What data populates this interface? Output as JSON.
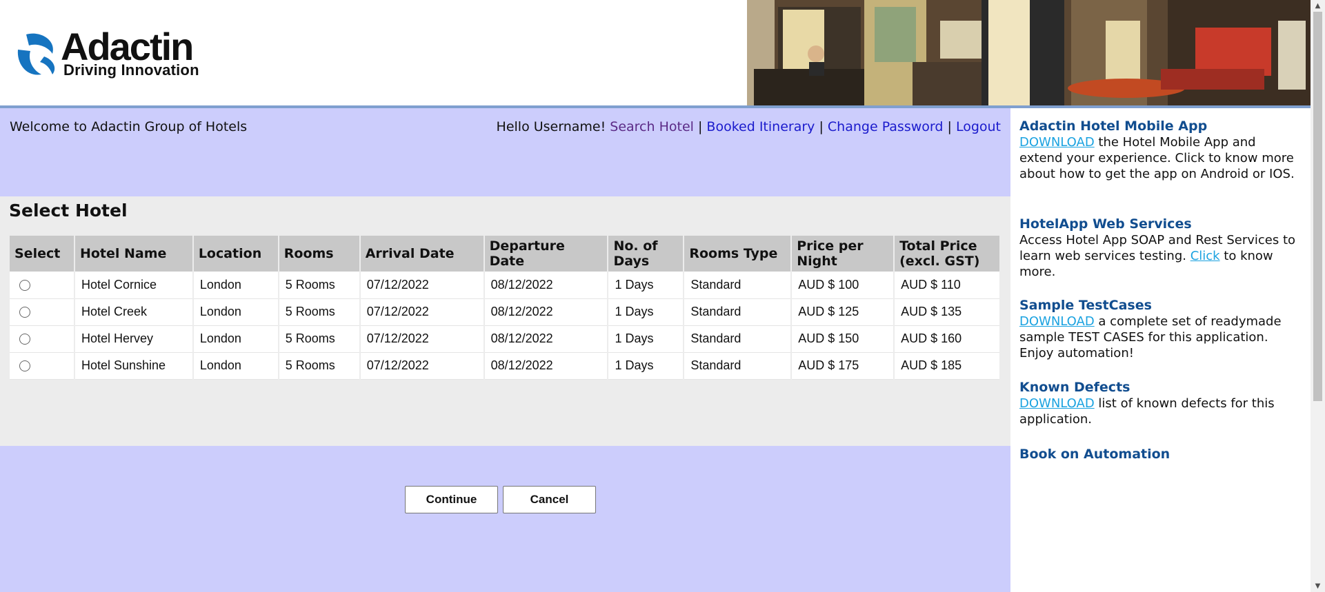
{
  "header": {
    "logo_name": "Adactin",
    "logo_tagline": "Driving Innovation"
  },
  "topbar": {
    "welcome": "Welcome to Adactin Group of Hotels",
    "greeting": "Hello Username!",
    "links": {
      "search_hotel": "Search Hotel",
      "booked_itinerary": "Booked Itinerary",
      "change_password": "Change Password",
      "logout": "Logout"
    },
    "separator": "|"
  },
  "main": {
    "heading": "Select Hotel",
    "table": {
      "columns": [
        "Select",
        "Hotel Name",
        "Location",
        "Rooms",
        "Arrival Date",
        "Departure Date",
        "No. of Days",
        "Rooms Type",
        "Price per Night",
        "Total Price (excl. GST)"
      ],
      "rows": [
        {
          "hotel": "Hotel Cornice",
          "location": "London",
          "rooms": "5 Rooms",
          "arrival": "07/12/2022",
          "departure": "08/12/2022",
          "days": "1 Days",
          "type": "Standard",
          "price": "AUD $ 100",
          "total": "AUD $ 110"
        },
        {
          "hotel": "Hotel Creek",
          "location": "London",
          "rooms": "5 Rooms",
          "arrival": "07/12/2022",
          "departure": "08/12/2022",
          "days": "1 Days",
          "type": "Standard",
          "price": "AUD $ 125",
          "total": "AUD $ 135"
        },
        {
          "hotel": "Hotel Hervey",
          "location": "London",
          "rooms": "5 Rooms",
          "arrival": "07/12/2022",
          "departure": "08/12/2022",
          "days": "1 Days",
          "type": "Standard",
          "price": "AUD $ 150",
          "total": "AUD $ 160"
        },
        {
          "hotel": "Hotel Sunshine",
          "location": "London",
          "rooms": "5 Rooms",
          "arrival": "07/12/2022",
          "departure": "08/12/2022",
          "days": "1 Days",
          "type": "Standard",
          "price": "AUD $ 175",
          "total": "AUD $ 185"
        }
      ]
    },
    "buttons": {
      "continue": "Continue",
      "cancel": "Cancel"
    }
  },
  "sidebar": {
    "mobile_app": {
      "title": "Adactin Hotel Mobile App",
      "link": "DOWNLOAD",
      "text": " the Hotel Mobile App and extend your experience. Click to know more about how to get the app on Android or IOS."
    },
    "web_services": {
      "title": "HotelApp Web Services",
      "text_before": "Access Hotel App SOAP and Rest Services to learn web services testing. ",
      "link": "Click",
      "text_after": " to know more."
    },
    "test_cases": {
      "title": "Sample TestCases",
      "link": "DOWNLOAD",
      "text": " a complete set of readymade sample TEST CASES for this application. Enjoy automation!"
    },
    "known_defects": {
      "title": "Known Defects",
      "link": "DOWNLOAD",
      "text": " list of known defects for this application."
    },
    "book": {
      "title": "Book on Automation"
    }
  },
  "colors": {
    "main_bg": "#cccdfc",
    "content_bg": "#ececec",
    "sidebar_title": "#114d8f",
    "sidebar_link": "#1aa2e0",
    "nav_link": "#1a1acc",
    "nav_link_visited": "#5b2a86"
  }
}
